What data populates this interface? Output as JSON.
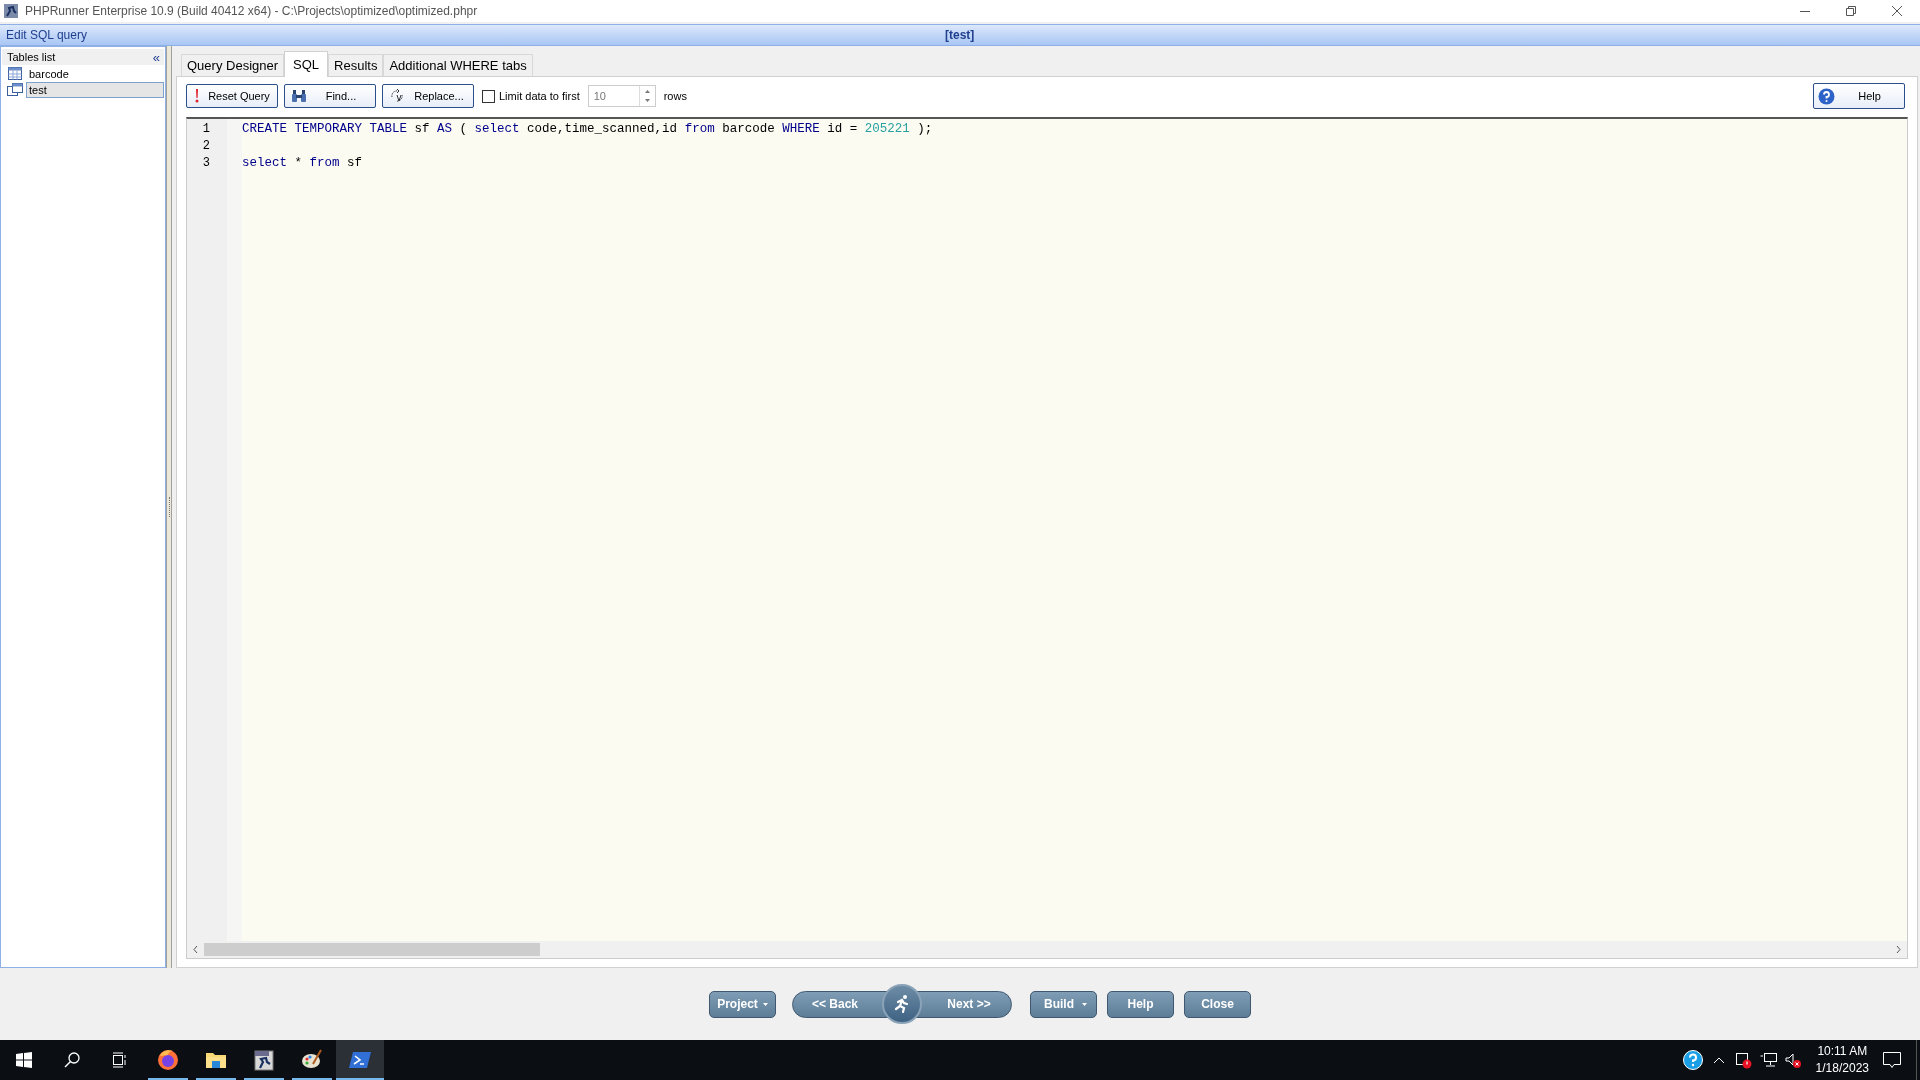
{
  "window": {
    "title": "PHPRunner Enterprise 10.9 (Build 40412 x64) - C:\\Projects\\optimized\\optimized.phpr"
  },
  "header": {
    "title": "Edit SQL query",
    "table": "[test]"
  },
  "tables_list": {
    "title": "Tables list",
    "collapse": "«",
    "items": [
      {
        "label": "barcode",
        "kind": "table",
        "selected": false
      },
      {
        "label": "test",
        "kind": "query",
        "selected": true
      }
    ]
  },
  "tabs": [
    {
      "label": "Query Designer",
      "selected": false
    },
    {
      "label": "SQL",
      "selected": true
    },
    {
      "label": "Results",
      "selected": false
    },
    {
      "label": "Additional WHERE tabs",
      "selected": false
    }
  ],
  "toolbar": {
    "buttons": [
      {
        "label": "Reset Query",
        "kind": "reset"
      },
      {
        "label": "Find...",
        "kind": "find"
      },
      {
        "label": "Replace...",
        "kind": "replace"
      }
    ],
    "limit": {
      "label": "Limit data to first",
      "checked": false,
      "value": "10",
      "unit": "rows"
    },
    "help": "Help"
  },
  "editor": {
    "lines": [
      {
        "number": "1",
        "tokens": [
          {
            "text": "CREATE TEMPORARY TABLE",
            "kind": "keyword"
          },
          {
            "text": " sf ",
            "kind": "plain"
          },
          {
            "text": "AS",
            "kind": "keyword"
          },
          {
            "text": " ( ",
            "kind": "plain"
          },
          {
            "text": "select",
            "kind": "keyword"
          },
          {
            "text": " code,time_scanned,id ",
            "kind": "plain"
          },
          {
            "text": "from",
            "kind": "keyword"
          },
          {
            "text": " barcode ",
            "kind": "plain"
          },
          {
            "text": "WHERE",
            "kind": "keyword"
          },
          {
            "text": " id = ",
            "kind": "plain"
          },
          {
            "text": "205221",
            "kind": "number"
          },
          {
            "text": " );",
            "kind": "plain"
          }
        ]
      },
      {
        "number": "2"
      },
      {
        "number": "3",
        "tokens": [
          {
            "text": "select",
            "kind": "keyword"
          },
          {
            "text": " * ",
            "kind": "plain"
          },
          {
            "text": "from",
            "kind": "keyword"
          },
          {
            "text": " sf",
            "kind": "plain"
          }
        ]
      }
    ]
  },
  "footer": {
    "project": "Project",
    "back": "<< Back",
    "next": "Next >>",
    "buttons": [
      {
        "label": "Build",
        "kind": "dropdown"
      },
      {
        "label": "Help",
        "kind": "plain"
      },
      {
        "label": "Close",
        "kind": "plain"
      }
    ]
  },
  "taskbar": {
    "apps": [
      {
        "kind": "firefox",
        "running": true,
        "selected": false
      },
      {
        "kind": "folder",
        "running": true,
        "selected": false
      },
      {
        "kind": "phprunner",
        "running": true,
        "selected": false
      },
      {
        "kind": "palette",
        "running": true,
        "selected": false
      },
      {
        "kind": "terminal",
        "running": true,
        "selected": true
      }
    ],
    "time": "10:11 AM",
    "date": "1/18/2023"
  }
}
